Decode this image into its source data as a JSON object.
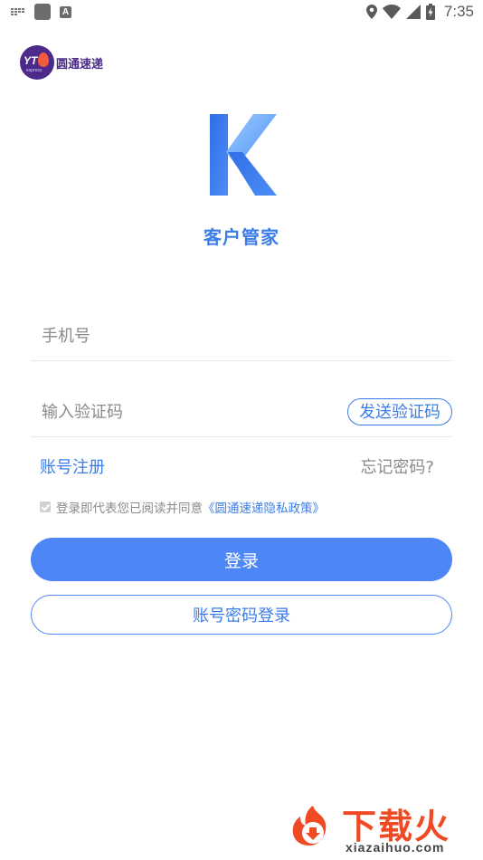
{
  "status_bar": {
    "a_icon_label": "A",
    "time": "7:35"
  },
  "brand": {
    "logo_text": "YT",
    "logo_subtext": "express",
    "name": "圆通速递"
  },
  "app": {
    "name": "客户管家",
    "logo_color_primary": "#3b7de8",
    "logo_color_secondary": "#79b4ff"
  },
  "form": {
    "phone_placeholder": "手机号",
    "code_placeholder": "输入验证码",
    "send_code_label": "发送验证码",
    "register_label": "账号注册",
    "forgot_label": "忘记密码?",
    "agree_text": "登录即代表您已阅读并同意",
    "policy_link": "《圆通速递隐私政策》",
    "agree_checked": true,
    "login_label": "登录",
    "password_login_label": "账号密码登录"
  },
  "watermark": {
    "text": "下载火",
    "url": "xiazaihuo.com"
  },
  "colors": {
    "accent": "#4d86f7",
    "link": "#3b7de8",
    "placeholder": "#8a8a8a",
    "watermark": "#ef4a23"
  }
}
